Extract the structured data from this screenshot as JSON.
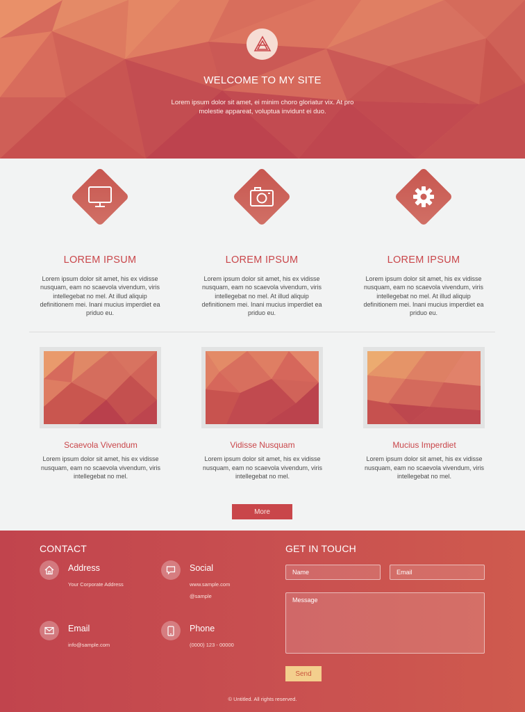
{
  "hero": {
    "title": "WELCOME TO MY SITE",
    "text": "Lorem ipsum dolor sit amet, ei minim choro gloriatur vix. At pro molestie appareat, voluptua invidunt ei duo.",
    "logo_icon": "triangle-logo-icon"
  },
  "features": [
    {
      "icon": "monitor-icon",
      "title": "LOREM IPSUM",
      "text": "Lorem ipsum dolor sit amet, his ex vidisse nusquam, eam no scaevola vivendum, viris intellegebat no mel. At illud aliquip definitionem mei. Inani mucius imperdiet ea priduo eu."
    },
    {
      "icon": "camera-icon",
      "title": "LOREM IPSUM",
      "text": "Lorem ipsum dolor sit amet, his ex vidisse nusquam, eam no scaevola vivendum, viris intellegebat no mel. At illud aliquip definitionem mei. Inani mucius imperdiet ea priduo eu."
    },
    {
      "icon": "gear-icon",
      "title": "LOREM IPSUM",
      "text": "Lorem ipsum dolor sit amet, his ex vidisse nusquam, eam no scaevola vivendum, viris intellegebat no mel. At illud aliquip definitionem mei. Inani mucius imperdiet ea priduo eu."
    }
  ],
  "gallery": [
    {
      "title": "Scaevola Vivendum",
      "text": "Lorem ipsum dolor sit amet, his ex vidisse nusquam, eam no scaevola vivendum, viris intellegebat no mel."
    },
    {
      "title": "Vidisse Nusquam",
      "text": "Lorem ipsum dolor sit amet, his ex vidisse nusquam, eam no scaevola vivendum, viris intellegebat no mel."
    },
    {
      "title": "Mucius Imperdiet",
      "text": "Lorem ipsum dolor sit amet, his ex vidisse nusquam, eam no scaevola vivendum, viris intellegebat no mel."
    }
  ],
  "more_label": "More",
  "contact": {
    "title": "CONTACT",
    "address": {
      "label": "Address",
      "value": "Your Corporate Address",
      "icon": "home-icon"
    },
    "social": {
      "label": "Social",
      "value1": "www.sample.com",
      "value2": "@sample",
      "icon": "chat-bubble-icon"
    },
    "email": {
      "label": "Email",
      "value": "info@sample.com",
      "icon": "envelope-icon"
    },
    "phone": {
      "label": "Phone",
      "value": "(0000) 123 - 00000",
      "icon": "phone-icon"
    }
  },
  "get_in_touch": {
    "title": "GET IN TOUCH",
    "name_placeholder": "Name",
    "email_placeholder": "Email",
    "message_placeholder": "Message",
    "send_label": "Send"
  },
  "copyright": "© Untitled. All rights reserved.",
  "colors": {
    "accent": "#c9464a",
    "hero_base": "#d4645a",
    "footer": "#c64a4e",
    "send_button": "#f3cf8d",
    "background": "#f2f3f3"
  }
}
